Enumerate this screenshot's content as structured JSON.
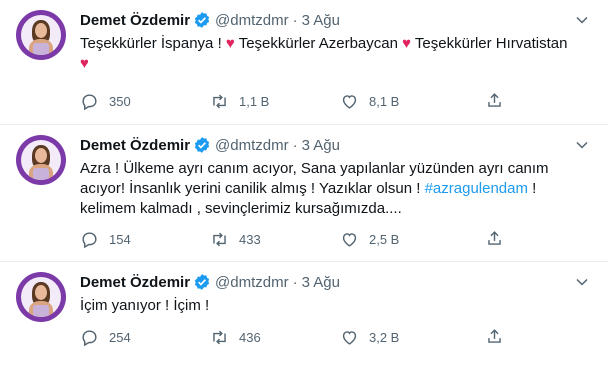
{
  "tweets": [
    {
      "name": "Demet Özdemir",
      "handle": "@dmtzdmr",
      "dot": "·",
      "date": "3 Ağu",
      "text_parts": [
        "Teşekkürler İspanya ! ",
        " Teşekkürler Azerbaycan ",
        " Teşekkürler Hırvatistan"
      ],
      "heart": "♥",
      "replies": "350",
      "retweets": "1,1 B",
      "likes": "8,1 B"
    },
    {
      "name": "Demet Özdemir",
      "handle": "@dmtzdmr",
      "dot": "·",
      "date": "3 Ağu",
      "text_before": "Azra ! Ülkeme ayrı canım acıyor, Sana yapılanlar yüzünden ayrı canım acıyor! İnsanlık yerini canilik almış ! Yazıklar olsun ! ",
      "hashtag": "#azragulendam",
      "text_after": " ! kelimem kalmadı , sevinçlerimiz kursağımızda....",
      "replies": "154",
      "retweets": "433",
      "likes": "2,5 B"
    },
    {
      "name": "Demet Özdemir",
      "handle": "@dmtzdmr",
      "dot": "·",
      "date": "3 Ağu",
      "text": "İçim yanıyor ! İçim !",
      "replies": "254",
      "retweets": "436",
      "likes": "3,2 B"
    }
  ],
  "colors": {
    "accent": "#1d9bf0",
    "heart": "#e0245e",
    "muted": "#536471",
    "avatar_ring": "#7c3aa8"
  },
  "icons": [
    "verified-badge-icon",
    "caret-down-icon",
    "reply-icon",
    "retweet-icon",
    "like-icon",
    "share-icon"
  ]
}
